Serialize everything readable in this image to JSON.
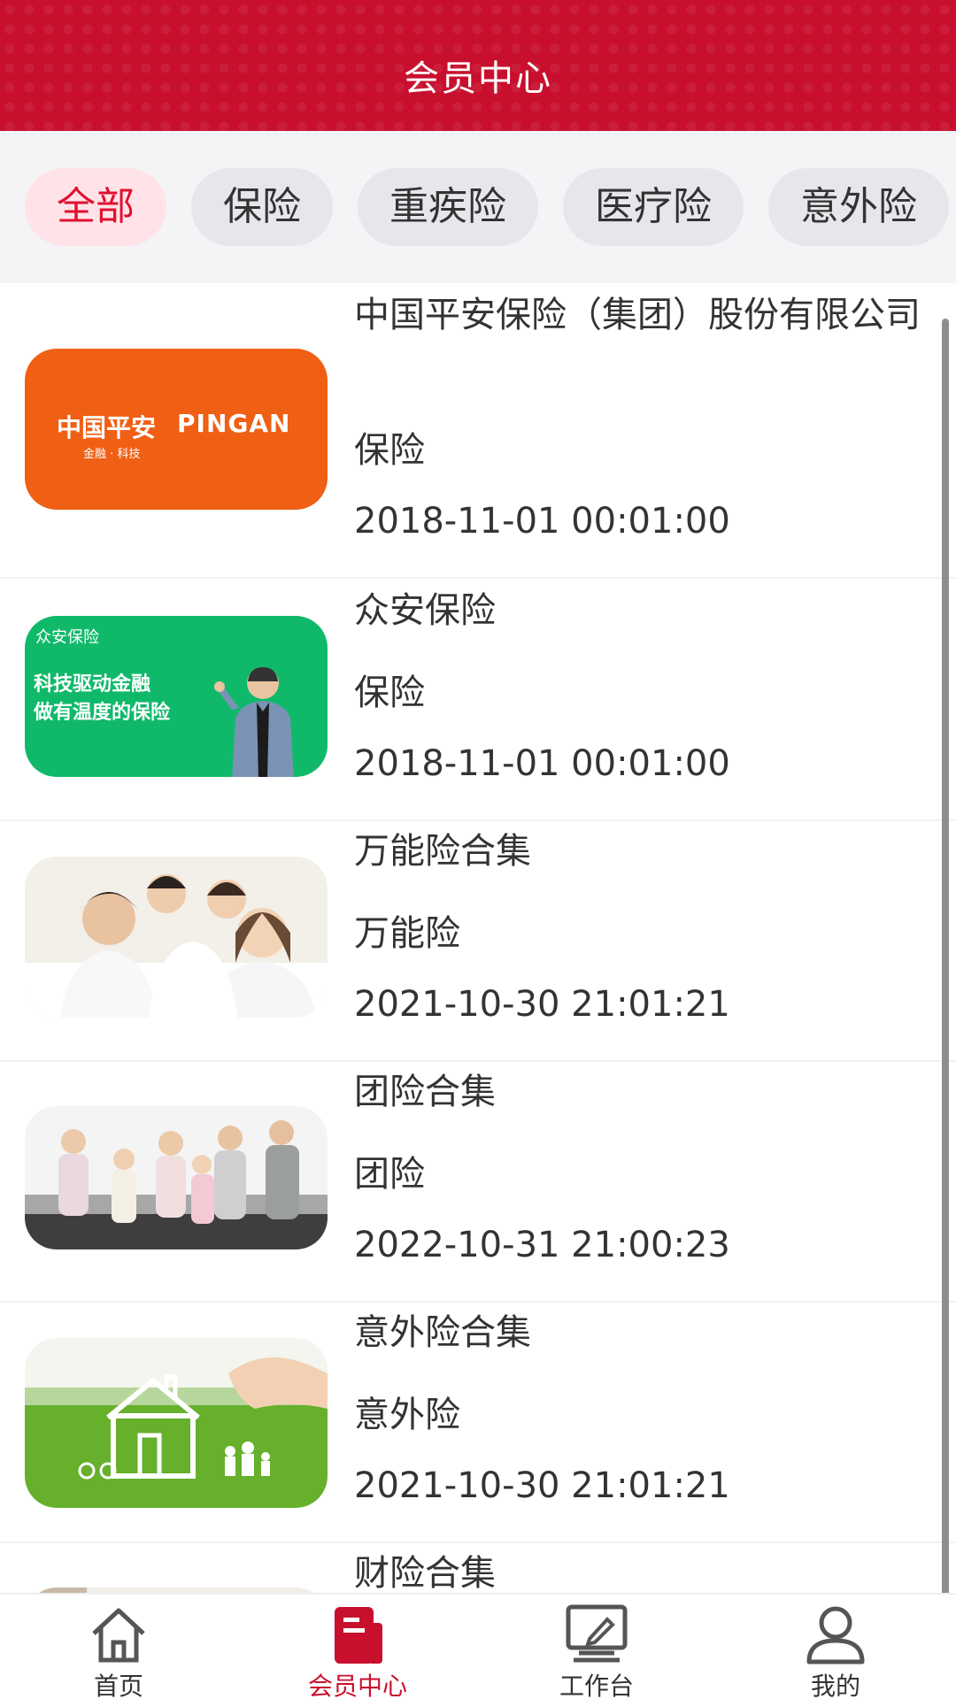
{
  "header": {
    "title": "会员中心"
  },
  "tabs": [
    {
      "label": "全部",
      "active": true
    },
    {
      "label": "保险",
      "active": false
    },
    {
      "label": "重疾险",
      "active": false
    },
    {
      "label": "医疗险",
      "active": false
    },
    {
      "label": "意外险",
      "active": false
    }
  ],
  "items": [
    {
      "name": "中国平安保险（集团）股份有限公司",
      "category": "保险",
      "date": "2018-11-01 00:01:00",
      "thumb": {
        "logo_cn": "中国平安",
        "logo_en": "PINGAN",
        "logo_sub": "金融 · 科技"
      }
    },
    {
      "name": "众安保险",
      "category": "保险",
      "date": "2018-11-01 00:01:00",
      "thumb": {
        "brand": "众安保险",
        "slogan_1": "科技驱动金融",
        "slogan_2": "做有温度的保险"
      }
    },
    {
      "name": "万能险合集",
      "category": "万能险",
      "date": "2021-10-30 21:01:21"
    },
    {
      "name": "团险合集",
      "category": "团险",
      "date": "2022-10-31 21:00:23"
    },
    {
      "name": "意外险合集",
      "category": "意外险",
      "date": "2021-10-30 21:01:21"
    },
    {
      "name": "财险合集"
    }
  ],
  "bottom_nav": [
    {
      "label": "首页",
      "icon": "home-icon",
      "active": false
    },
    {
      "label": "会员中心",
      "icon": "member-center-icon",
      "active": true
    },
    {
      "label": "工作台",
      "icon": "workbench-icon",
      "active": false
    },
    {
      "label": "我的",
      "icon": "user-icon",
      "active": false
    }
  ],
  "colors": {
    "brand_red": "#c8102e",
    "tab_active_bg": "#ffe3e8",
    "tab_active_text": "#e0102f",
    "tab_bg": "#e6e7eb",
    "pingan_orange": "#ef5f14",
    "zhongan_green": "#10b96a"
  }
}
